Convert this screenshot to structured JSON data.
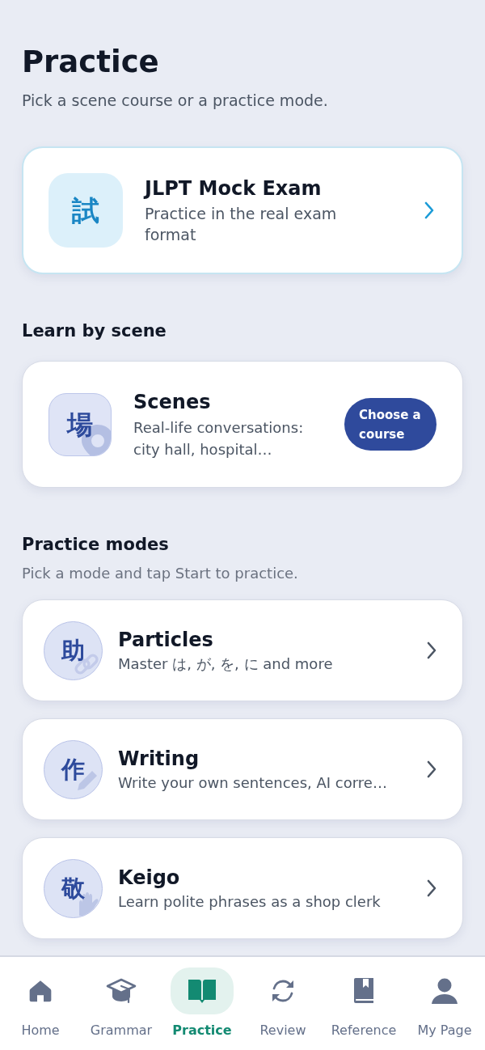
{
  "header": {
    "title": "Practice",
    "subtitle": "Pick a scene course or a practice mode."
  },
  "mock_exam": {
    "icon_char": "試",
    "title": "JLPT Mock Exam",
    "subtitle": "Practice in the real exam format"
  },
  "scene_section": {
    "heading": "Learn by scene",
    "card": {
      "icon_char": "場",
      "title": "Scenes",
      "subtitle": "Real-life conversations: city hall, hospital…",
      "button": "Choose a course"
    }
  },
  "modes_section": {
    "heading": "Practice modes",
    "subtitle": "Pick a mode and tap Start to practice.",
    "items": [
      {
        "icon_char": "助",
        "title": "Particles",
        "subtitle": "Master は, が, を, に and more"
      },
      {
        "icon_char": "作",
        "title": "Writing",
        "subtitle": "Write your own sentences, AI corre…"
      },
      {
        "icon_char": "敬",
        "title": "Keigo",
        "subtitle": "Learn polite phrases as a shop clerk"
      }
    ]
  },
  "bottom_nav": [
    {
      "label": "Home",
      "selected": false
    },
    {
      "label": "Grammar",
      "selected": false
    },
    {
      "label": "Practice",
      "selected": true
    },
    {
      "label": "Review",
      "selected": false
    },
    {
      "label": "Reference",
      "selected": false
    },
    {
      "label": "My Page",
      "selected": false
    }
  ]
}
